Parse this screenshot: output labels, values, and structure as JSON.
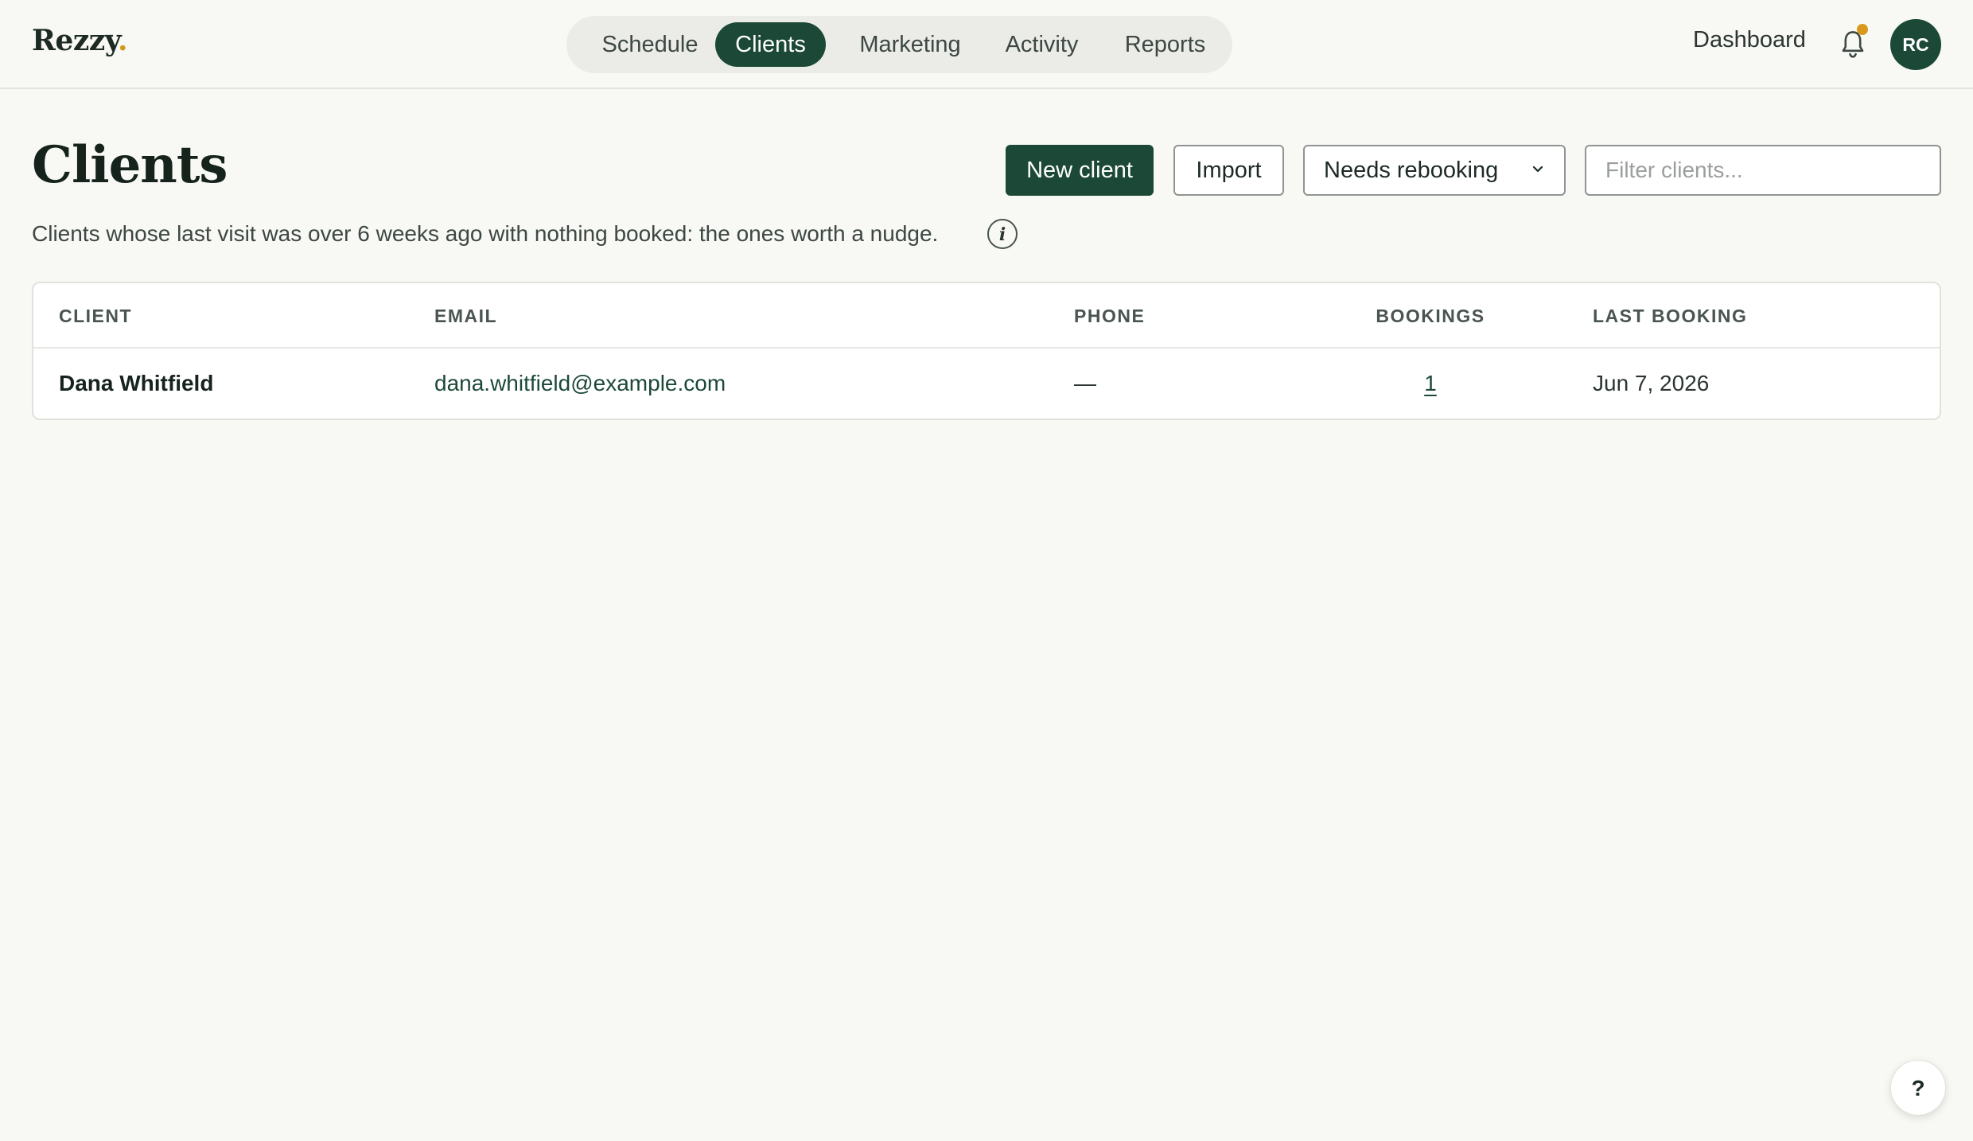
{
  "app": {
    "logo_text": "Rezzy",
    "logo_dot": ".",
    "accent_color": "#1c4937",
    "notification_color": "#d99a1b"
  },
  "nav": {
    "items": [
      {
        "label": "Schedule",
        "active": false
      },
      {
        "label": "Clients",
        "active": true
      },
      {
        "label": "Marketing",
        "active": false
      },
      {
        "label": "Activity",
        "active": false
      },
      {
        "label": "Reports",
        "active": false
      }
    ]
  },
  "topbar": {
    "dashboard_label": "Dashboard",
    "notifications_icon": "bell-icon",
    "avatar_initials": "RC"
  },
  "header": {
    "title": "Clients",
    "subtitle": "Clients whose last visit was over 6 weeks ago with nothing booked: the ones worth a nudge.",
    "info_icon": "info-icon"
  },
  "toolbar": {
    "new_client_label": "New client",
    "import_label": "Import",
    "segment_selected": "Needs rebooking",
    "filter_placeholder": "Filter clients..."
  },
  "table": {
    "columns": [
      "CLIENT",
      "EMAIL",
      "PHONE",
      "BOOKINGS",
      "LAST BOOKING"
    ],
    "rows": [
      {
        "client": "Dana Whitfield",
        "email": "dana.whitfield@example.com",
        "phone": "—",
        "bookings": "1",
        "last_booking": "Jun 7, 2026"
      }
    ]
  },
  "help": {
    "label": "?"
  }
}
